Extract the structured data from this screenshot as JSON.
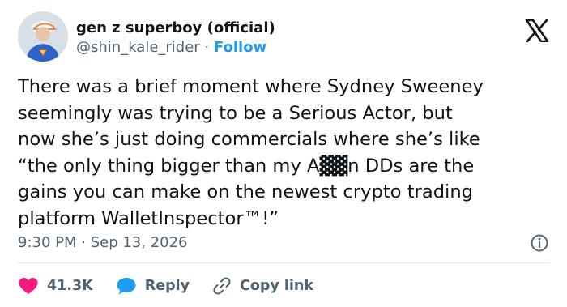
{
  "author": {
    "display_name": "gen z superboy (official)",
    "handle": "@shin_kale_rider",
    "separator": "·",
    "follow_label": "Follow"
  },
  "tweet": {
    "text": "There was a brief moment where Sydney Sweeney\nseemingly was trying to be a Serious Actor, but\nnow she’s just doing commercials where she’s like\n“the only thing bigger than my A▓▓n DDs are the\ngains you can make on the newest crypto trading\nplatform WalletInspector™!”",
    "timestamp": "9:30 PM · Sep 13, 2026"
  },
  "actions": {
    "likes": "41.3K",
    "reply_label": "Reply",
    "copy_link_label": "Copy link"
  },
  "icons": {
    "brand": "x-logo-icon",
    "info": "info-icon",
    "like": "heart-icon",
    "reply": "speech-bubble-icon",
    "copy": "link-icon"
  },
  "colors": {
    "accent": "#1d9bf0",
    "like": "#f91880",
    "text": "#0f1419",
    "secondary": "#536471"
  }
}
